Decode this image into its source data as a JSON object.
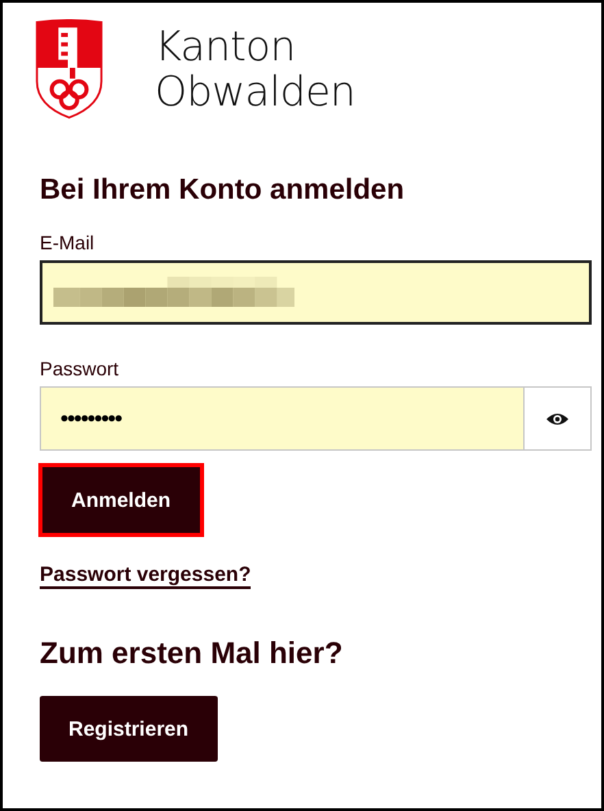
{
  "logo": {
    "line_1": "Kanton",
    "line_2": "Obwalden"
  },
  "login": {
    "heading": "Bei Ihrem Konto anmelden",
    "email": {
      "label": "E-Mail",
      "focused": true,
      "redacted": true
    },
    "password": {
      "label": "Passwort",
      "value": "•••••••••",
      "focused": false
    },
    "submit": {
      "label": "Anmelden",
      "focused": true
    },
    "forgot_link": "Passwort vergessen?"
  },
  "register": {
    "heading": "Zum ersten Mal hier?",
    "button": "Registrieren"
  }
}
